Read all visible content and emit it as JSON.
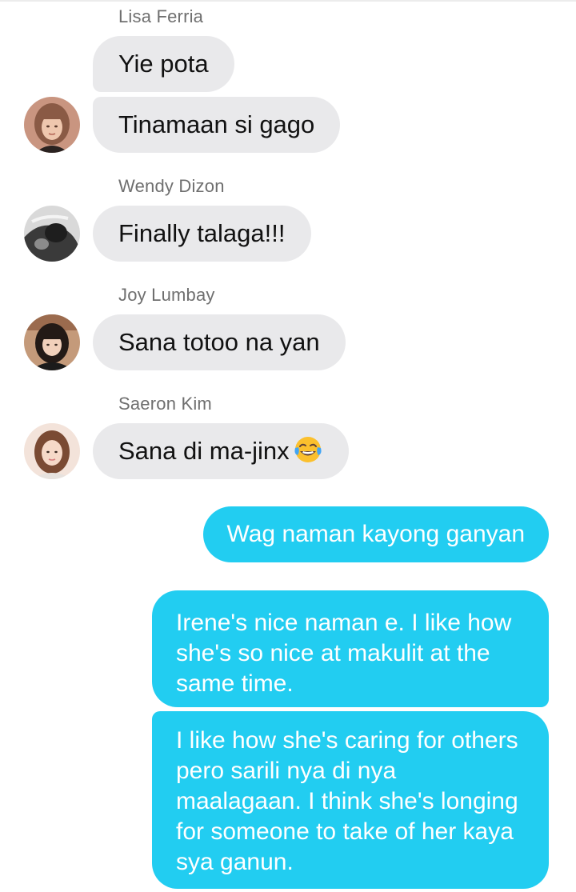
{
  "messages": {
    "lisa": {
      "sender": "Lisa Ferria",
      "msg1": "Yie pota",
      "msg2": "Tinamaan si gago"
    },
    "wendy": {
      "sender": "Wendy Dizon",
      "msg1": "Finally talaga!!!"
    },
    "joy": {
      "sender": "Joy Lumbay",
      "msg1": "Sana totoo na yan"
    },
    "saeron": {
      "sender": "Saeron Kim",
      "msg1": "Sana di ma-jinx",
      "emoji": "face-with-tears-of-joy"
    },
    "me": {
      "msg1": "Wag naman kayong ganyan",
      "msg2": "Irene's nice naman e. I like how she's so nice at makulit at the same time.",
      "msg3": "I like how she's caring for others pero sarili nya di nya maalagaan. I think she's longing for someone to take of her kaya sya ganun."
    }
  },
  "colors": {
    "incoming_bubble": "#e9e9eb",
    "outgoing_bubble": "#22cdf1",
    "sender_name": "#6f6f6f"
  }
}
